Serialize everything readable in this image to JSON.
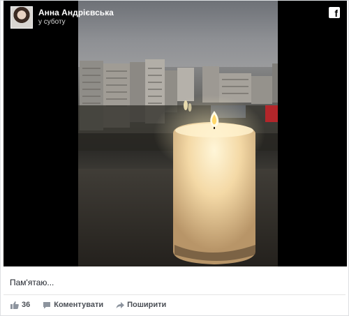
{
  "post": {
    "author": "Анна Андрієвська",
    "time": "у суботу",
    "caption": "Пам'ятаю...",
    "likes": "36",
    "comment_label": "Коментувати",
    "share_label": "Поширити"
  },
  "icons": {
    "brand": "facebook-icon",
    "like": "thumbs-up-icon",
    "comment": "speech-bubble-icon",
    "share": "share-arrow-icon"
  },
  "colors": {
    "divider": "#e5e5e5",
    "text": "#1d2129",
    "action_text": "#4b4f56",
    "icon": "#8d949e"
  }
}
